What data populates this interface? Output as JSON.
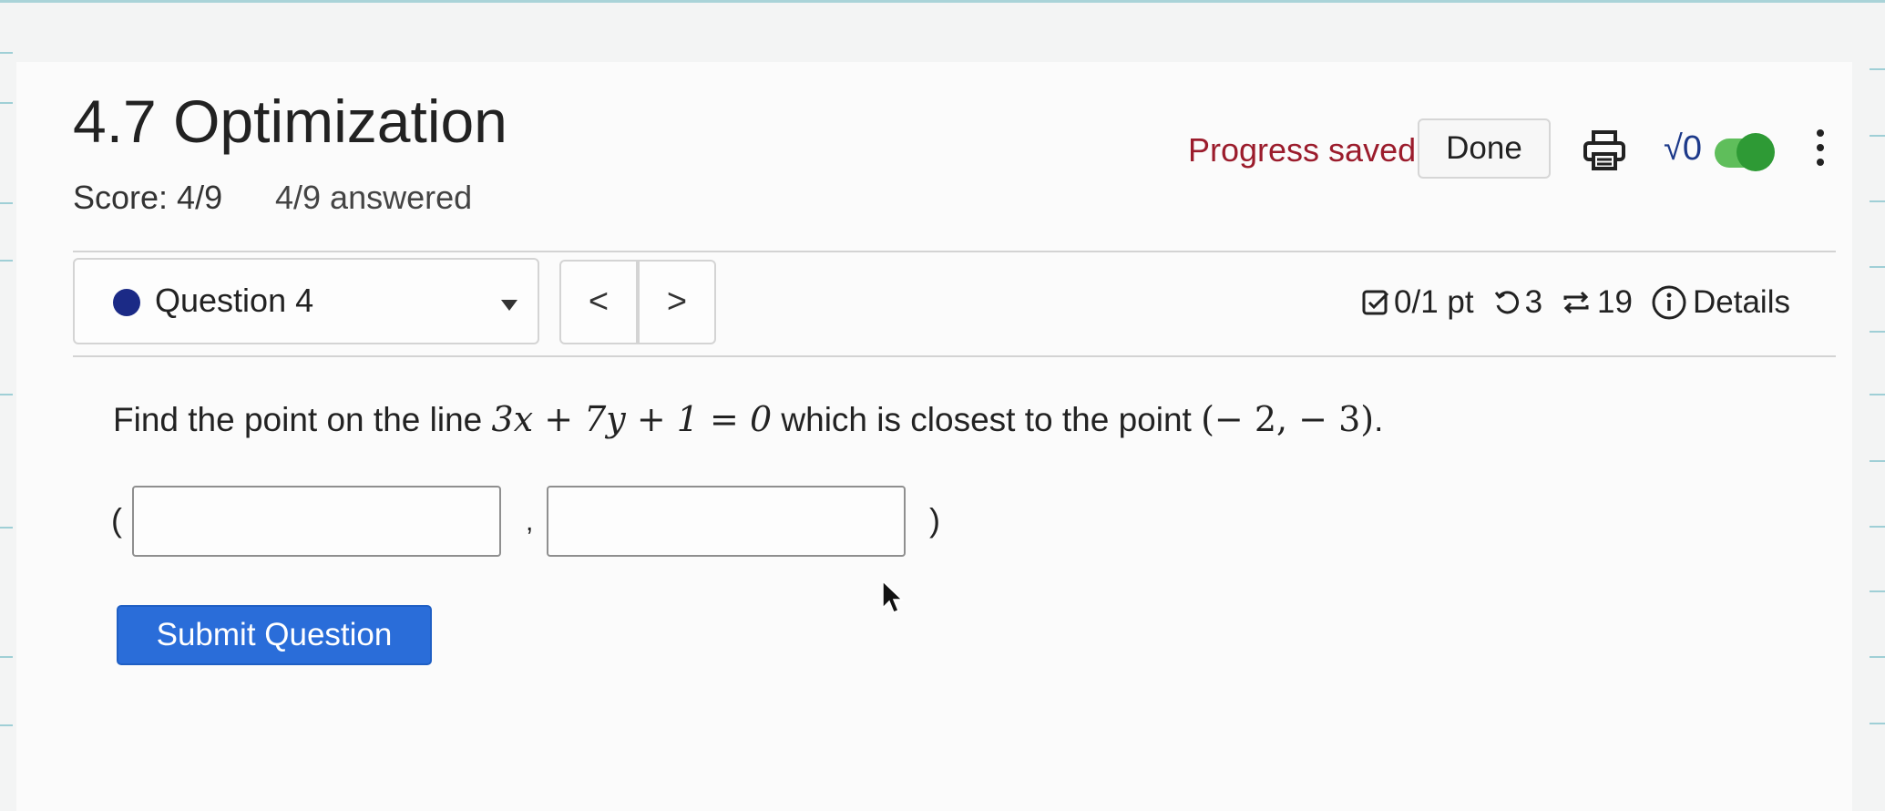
{
  "assignment": {
    "title": "4.7 Optimization",
    "score": "Score: 4/9",
    "answered": "4/9 answered"
  },
  "toolbar": {
    "status": "Progress saved",
    "done_label": "Done",
    "math_toggle_label": "√0",
    "math_toggle_on": true
  },
  "question_nav": {
    "selected": "Question 4",
    "prev_label": "<",
    "next_label": ">"
  },
  "question_stats": {
    "points": "0/1 pt",
    "retries": "3",
    "attempts": "19",
    "details_label": "Details"
  },
  "question": {
    "text_before": "Find the point on the line ",
    "equation": "3x + 7y + 1 = 0",
    "text_middle": " which is closest to the point ",
    "point": "(− 2, − 3)",
    "text_after": "."
  },
  "answer": {
    "open_paren": "(",
    "separator": ",",
    "close_paren": ")",
    "x_value": "",
    "y_value": ""
  },
  "submit_label": "Submit Question",
  "colors": {
    "status_text": "#9b1c2c",
    "accent_blue": "#2a6dd9",
    "question_dot": "#1b2a86",
    "toggle_green": "#2e9a35"
  }
}
